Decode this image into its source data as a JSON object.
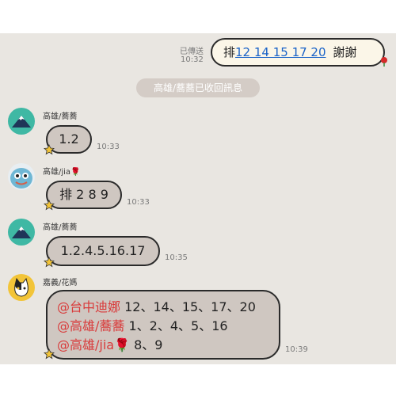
{
  "messages": {
    "m1": {
      "status": "已傳送",
      "time": "10:32",
      "prefix": "排",
      "link": "12 14 15 17 20",
      "suffix": "謝謝"
    },
    "notice": "高雄/蕎蕎已收回訊息",
    "m2": {
      "sender": "高雄/蕎蕎",
      "text": "1.2",
      "time": "10:33"
    },
    "m3": {
      "sender": "高雄/jia",
      "text": "排 2 8 9",
      "time": "10:33"
    },
    "m4": {
      "sender": "高雄/蕎蕎",
      "text": "1.2.4.5.16.17",
      "time": "10:35"
    },
    "m5": {
      "sender": "嘉義/花媽",
      "time": "10:39",
      "lines": [
        {
          "mention": "@台中迪娜",
          "text": " 12、14、15、17、20"
        },
        {
          "mention": "@高雄/蕎蕎",
          "text": " 1、2、4、5、16"
        },
        {
          "mention": "@高雄/jia",
          "text": " 8、9"
        }
      ]
    }
  },
  "icons": {
    "rose": "rose-emoji-icon",
    "star": "star-sticker-icon",
    "avatar_mountain": "mountain-avatar-icon",
    "avatar_hangyodon": "hangyodon-avatar-icon",
    "avatar_cat": "cat-avatar-icon"
  },
  "colors": {
    "chat_bg": "#e9e6e1",
    "incoming_bubble": "#cfc7c1",
    "outgoing_bubble": "#fbf6e8",
    "mention": "#d93a3a",
    "link": "#1a63c8"
  }
}
